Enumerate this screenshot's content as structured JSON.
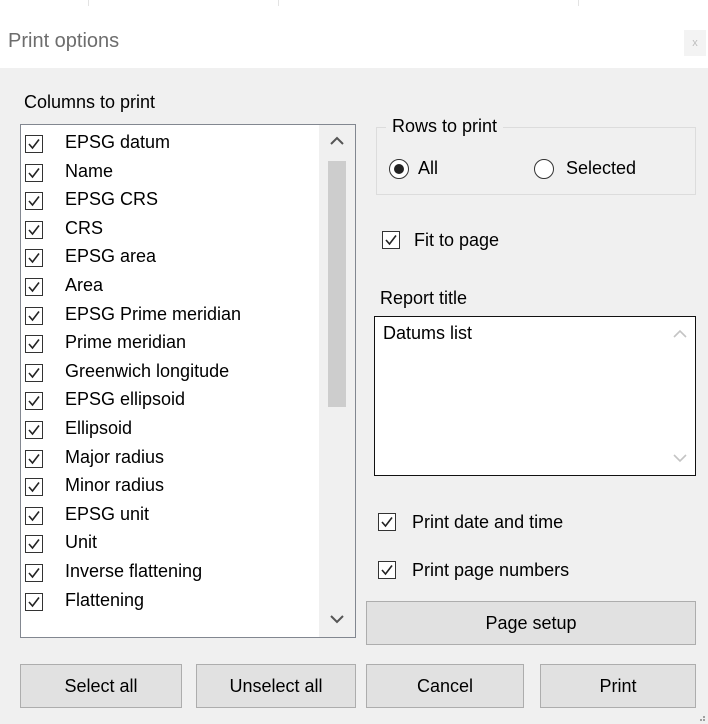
{
  "window": {
    "title": "Print options",
    "close_label": "x"
  },
  "columns": {
    "label": "Columns to print",
    "items": [
      {
        "label": "EPSG datum",
        "checked": true
      },
      {
        "label": "Name",
        "checked": true
      },
      {
        "label": "EPSG CRS",
        "checked": true
      },
      {
        "label": "CRS",
        "checked": true
      },
      {
        "label": "EPSG area",
        "checked": true
      },
      {
        "label": "Area",
        "checked": true
      },
      {
        "label": "EPSG Prime meridian",
        "checked": true
      },
      {
        "label": "Prime meridian",
        "checked": true
      },
      {
        "label": "Greenwich longitude",
        "checked": true
      },
      {
        "label": "EPSG ellipsoid",
        "checked": true
      },
      {
        "label": "Ellipsoid",
        "checked": true
      },
      {
        "label": "Major radius",
        "checked": true
      },
      {
        "label": "Minor radius",
        "checked": true
      },
      {
        "label": "EPSG unit",
        "checked": true
      },
      {
        "label": "Unit",
        "checked": true
      },
      {
        "label": "Inverse flattening",
        "checked": true
      },
      {
        "label": "Flattening",
        "checked": true
      }
    ]
  },
  "rows": {
    "label": "Rows to print",
    "options": [
      {
        "label": "All",
        "selected": true
      },
      {
        "label": "Selected",
        "selected": false
      }
    ]
  },
  "fit_to_page": {
    "label": "Fit to page",
    "checked": true
  },
  "report_title": {
    "label": "Report title",
    "value": "Datums list"
  },
  "print_date_time": {
    "label": "Print date and time",
    "checked": true
  },
  "print_page_numbers": {
    "label": "Print page numbers",
    "checked": true
  },
  "buttons": {
    "page_setup": "Page setup",
    "select_all": "Select all",
    "unselect_all": "Unselect all",
    "cancel": "Cancel",
    "print": "Print"
  },
  "icons": {
    "check": "check-icon",
    "scroll_up": "chevron-up-icon",
    "scroll_down": "chevron-down-icon",
    "close": "close-icon"
  }
}
